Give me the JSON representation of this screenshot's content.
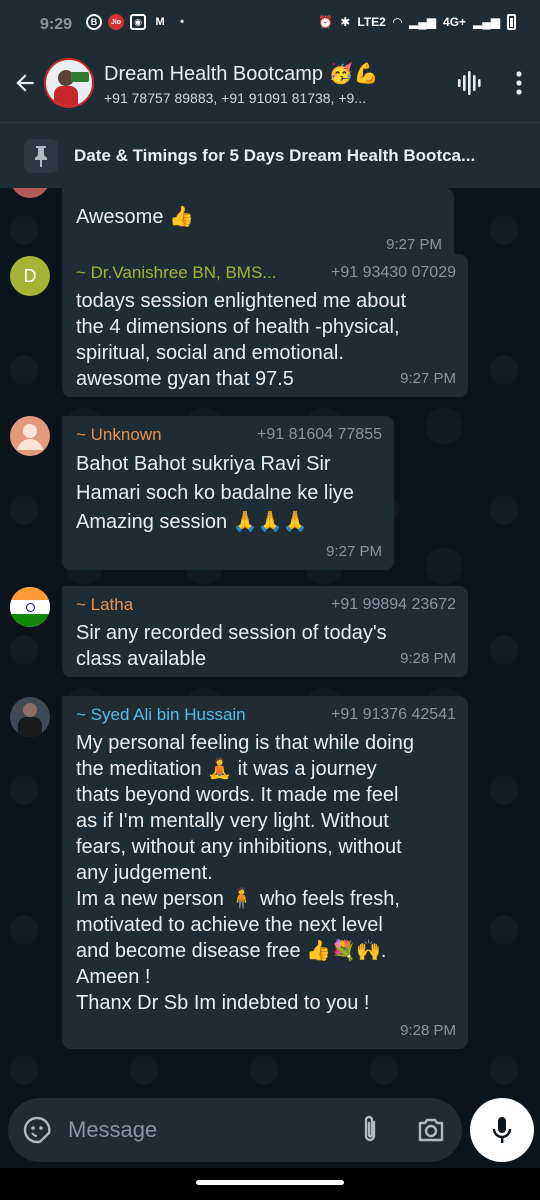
{
  "status_bar": {
    "time": "9:29",
    "network": "4G+"
  },
  "header": {
    "title": "Dream Health Bootcamp 🥳💪",
    "subtitle": "+91 78757 89883, +91 91091 81738, +9..."
  },
  "pinned": {
    "text": "Date & Timings for 5 Days Dream Health Bootca..."
  },
  "messages": [
    {
      "text": "Awesome 👍",
      "time": "9:27 PM"
    },
    {
      "sender": "~ Dr.Vanishree BN, BMS...",
      "sender_color": "#a5b337",
      "avatar_letter": "D",
      "phone": "+91 93430 07029",
      "text": "todays session  enlightened me about\nthe 4 dimensions of health -physical,\nspiritual, social and emotional.\nawesome gyan that 97.5",
      "time": "9:27 PM"
    },
    {
      "sender": "~ Unknown",
      "sender_color": "#e6904e",
      "phone": "+91 81604 77855",
      "text": "Bahot Bahot  sukriya Ravi Sir\nHamari soch ko badalne ke liye\nAmazing session 🙏🙏🙏",
      "time": "9:27 PM"
    },
    {
      "sender": "~ Latha",
      "sender_color": "#e6904e",
      "phone": "+91 99894 23672",
      "text": "Sir any recorded session of today's\nclass available",
      "time": "9:28 PM"
    },
    {
      "sender": "~ Syed Ali bin Hussain",
      "sender_color": "#53bdeb",
      "phone": "+91 91376 42541",
      "text": "My personal feeling is that while doing\nthe meditation 🧘 it was a journey\nthats beyond words. It made me feel\nas if I'm mentally very light. Without\nfears, without any inhibitions, without\nany judgement.\nIm a new person 🧍 who feels fresh,\nmotivated to achieve the next level\nand become disease free 👍💐🙌.\nAmeen !\nThanx Dr Sb Im indebted to you !",
      "time": "9:28 PM"
    }
  ],
  "composer": {
    "placeholder": "Message"
  },
  "colors": {
    "background": "#0b141a",
    "bubble": "#202c33",
    "bar": "#1f2c34"
  }
}
